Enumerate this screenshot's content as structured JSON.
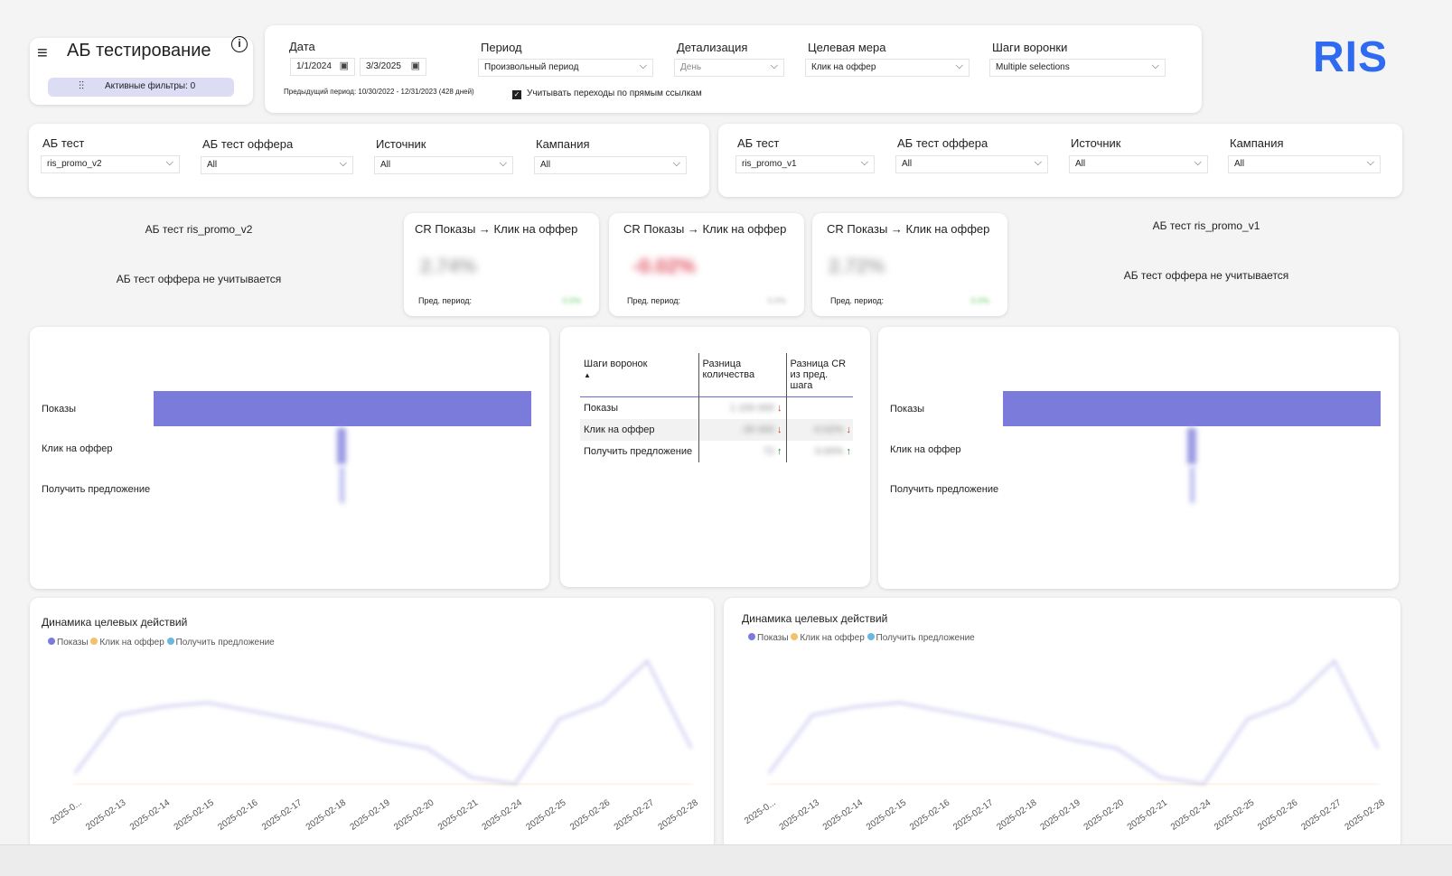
{
  "header": {
    "title": "АБ тестирование",
    "active_filters": "Активные фильтры: 0",
    "logo": "RIS",
    "logo_color": "#2f6bf0"
  },
  "filters": {
    "date_label": "Дата",
    "date_from": "1/1/2024",
    "date_to": "3/3/2025",
    "period_label": "Период",
    "period_value": "Произвольный период",
    "detail_label": "Детализация",
    "detail_value": "День",
    "measure_label": "Целевая мера",
    "measure_value": "Клик на оффер",
    "steps_label": "Шаги воронки",
    "steps_value": "Multiple selections",
    "prev_period": "Предыдущий период: 10/30/2022 - 12/31/2023 (428 дней)",
    "direct_links": "Учитывать переходы по прямым ссылкам",
    "direct_links_checked": true
  },
  "left_filters": {
    "ab_label": "АБ тест",
    "ab_value": "ris_promo_v2",
    "offer_label": "АБ тест оффера",
    "offer_value": "All",
    "source_label": "Источник",
    "source_value": "All",
    "campaign_label": "Кампания",
    "campaign_value": "All"
  },
  "right_filters": {
    "ab_label": "АБ тест",
    "ab_value": "ris_promo_v1",
    "offer_label": "АБ тест оффера",
    "offer_value": "All",
    "source_label": "Источник",
    "source_value": "All",
    "campaign_label": "Кампания",
    "campaign_value": "All"
  },
  "left_info": {
    "test": "АБ тест ris_promo_v2",
    "offer": "АБ тест оффера не учитывается"
  },
  "right_info": {
    "test": "АБ тест ris_promo_v1",
    "offer": "АБ тест оффера не учитывается"
  },
  "kpis": [
    {
      "title": "CR Показы → Клик на оффер",
      "value": "2.74%",
      "prev_label": "Пред. период:",
      "prev": "0.0%"
    },
    {
      "title": "CR Показы → Клик на оффер",
      "value": "-0.02%",
      "value_color": "#e05060",
      "prev_label": "Пред. период:",
      "prev": "0.0%"
    },
    {
      "title": "CR Показы → Клик на оффер",
      "value": "2.72%",
      "prev_label": "Пред. период:",
      "prev": "0.0%"
    }
  ],
  "funnel": {
    "steps": [
      "Показы",
      "Клик на оффер",
      "Получить предложение"
    ],
    "bar_color": "#7b7bdc"
  },
  "table": {
    "headers": [
      "Шаги воронок",
      "Разница количества",
      "Разница CR из пред. шага"
    ],
    "rows": [
      {
        "step": "Показы",
        "qty": "1 100 000",
        "qty_dir": "down",
        "cr": "",
        "cr_dir": ""
      },
      {
        "step": "Клик на оффер",
        "qty": "-30 000",
        "qty_dir": "down",
        "cr": "-0.02%",
        "cr_dir": "down"
      },
      {
        "step": "Получить предложение",
        "qty": "72",
        "qty_dir": "up",
        "cr": "0.00%",
        "cr_dir": "up"
      }
    ]
  },
  "chart_data": [
    {
      "type": "line",
      "title": "Динамика целевых действий",
      "categories": [
        "2025-0...",
        "2025-02-13",
        "2025-02-14",
        "2025-02-15",
        "2025-02-16",
        "2025-02-17",
        "2025-02-18",
        "2025-02-19",
        "2025-02-20",
        "2025-02-21",
        "2025-02-24",
        "2025-02-25",
        "2025-02-26",
        "2025-02-27",
        "2025-02-28"
      ],
      "series": [
        {
          "name": "Показы",
          "color": "#7b7bdc",
          "values": [
            15,
            85,
            95,
            100,
            90,
            80,
            70,
            55,
            45,
            10,
            2,
            80,
            100,
            150,
            45
          ]
        },
        {
          "name": "Клик на оффер",
          "color": "#f5c06b",
          "values": [
            3,
            3,
            3,
            3,
            3,
            3,
            3,
            3,
            3,
            2,
            1,
            3,
            3,
            3,
            3
          ]
        },
        {
          "name": "Получить предложение",
          "color": "#6ab7e0",
          "values": [
            0,
            0,
            0,
            0,
            0,
            0,
            0,
            0,
            0,
            0,
            0,
            0,
            0,
            0,
            0
          ]
        }
      ]
    },
    {
      "type": "line",
      "title": "Динамика целевых действий",
      "categories": [
        "2025-0...",
        "2025-02-13",
        "2025-02-14",
        "2025-02-15",
        "2025-02-16",
        "2025-02-17",
        "2025-02-18",
        "2025-02-19",
        "2025-02-20",
        "2025-02-21",
        "2025-02-24",
        "2025-02-25",
        "2025-02-26",
        "2025-02-27",
        "2025-02-28"
      ],
      "series": [
        {
          "name": "Показы",
          "color": "#7b7bdc",
          "values": [
            15,
            85,
            95,
            100,
            90,
            80,
            70,
            55,
            45,
            10,
            2,
            80,
            100,
            150,
            45
          ]
        },
        {
          "name": "Клик на оффер",
          "color": "#f5c06b",
          "values": [
            3,
            3,
            3,
            3,
            3,
            3,
            3,
            3,
            3,
            2,
            1,
            3,
            3,
            3,
            3
          ]
        },
        {
          "name": "Получить предложение",
          "color": "#6ab7e0",
          "values": [
            0,
            0,
            0,
            0,
            0,
            0,
            0,
            0,
            0,
            0,
            0,
            0,
            0,
            0,
            0
          ]
        }
      ]
    }
  ]
}
